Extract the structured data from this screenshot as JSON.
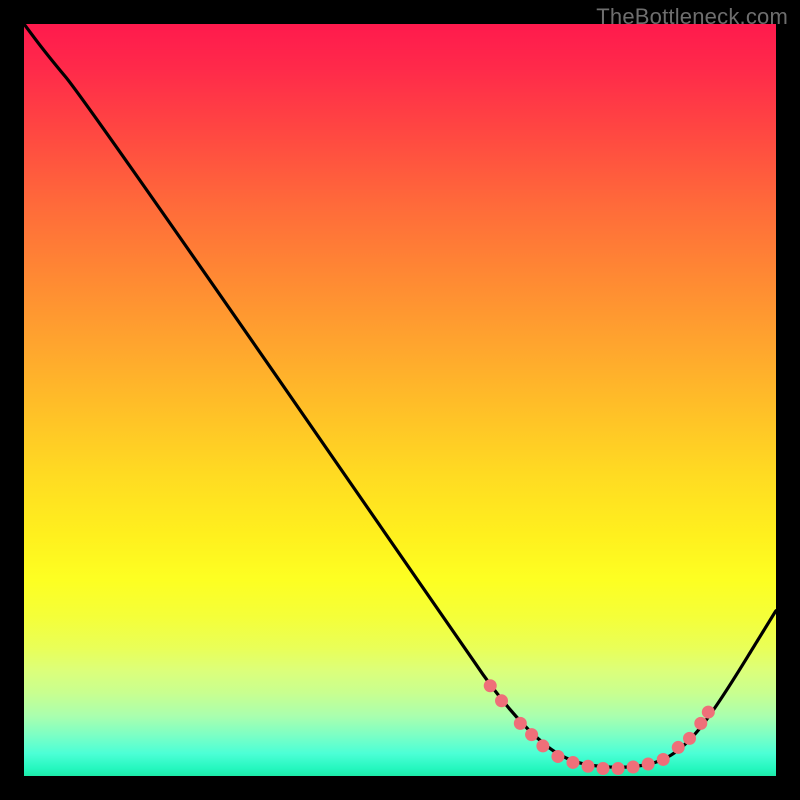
{
  "watermark": "TheBottleneck.com",
  "chart_data": {
    "type": "line",
    "title": "",
    "xlabel": "",
    "ylabel": "",
    "xlim": [
      0,
      100
    ],
    "ylim": [
      0,
      100
    ],
    "grid": false,
    "legend": false,
    "curve": [
      {
        "x": 0,
        "y": 100
      },
      {
        "x": 3,
        "y": 96
      },
      {
        "x": 8,
        "y": 90
      },
      {
        "x": 58,
        "y": 18
      },
      {
        "x": 62,
        "y": 12
      },
      {
        "x": 67,
        "y": 6
      },
      {
        "x": 72,
        "y": 2
      },
      {
        "x": 78,
        "y": 1
      },
      {
        "x": 84,
        "y": 1.5
      },
      {
        "x": 88,
        "y": 4
      },
      {
        "x": 92,
        "y": 9
      },
      {
        "x": 100,
        "y": 22
      }
    ],
    "points": [
      {
        "x": 62,
        "y": 12
      },
      {
        "x": 63.5,
        "y": 10
      },
      {
        "x": 66,
        "y": 7
      },
      {
        "x": 67.5,
        "y": 5.5
      },
      {
        "x": 69,
        "y": 4
      },
      {
        "x": 71,
        "y": 2.6
      },
      {
        "x": 73,
        "y": 1.8
      },
      {
        "x": 75,
        "y": 1.3
      },
      {
        "x": 77,
        "y": 1.0
      },
      {
        "x": 79,
        "y": 1.0
      },
      {
        "x": 81,
        "y": 1.2
      },
      {
        "x": 83,
        "y": 1.6
      },
      {
        "x": 85,
        "y": 2.2
      },
      {
        "x": 87,
        "y": 3.8
      },
      {
        "x": 88.5,
        "y": 5
      },
      {
        "x": 90,
        "y": 7
      },
      {
        "x": 91,
        "y": 8.5
      }
    ],
    "colors": {
      "line": "#000000",
      "point_fill": "#ef6f79",
      "point_stroke": "#ef6f79",
      "background_top": "#ff1a4d",
      "background_bottom": "#1de9a8"
    }
  }
}
